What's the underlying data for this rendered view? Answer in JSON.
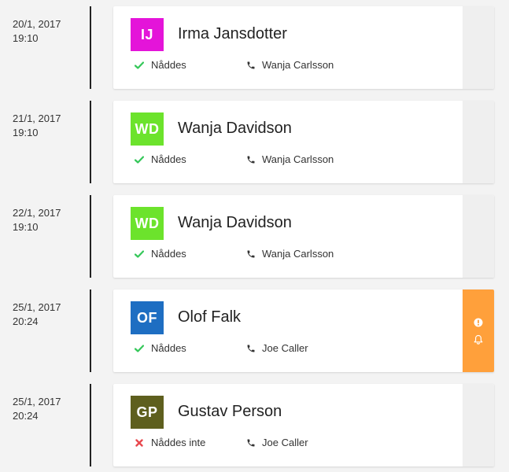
{
  "entries": [
    {
      "date": "20/1, 2017",
      "time": "19:10",
      "initials": "IJ",
      "avatar_color": "#e414d9",
      "name": "Irma Jansdotter",
      "status": "Nåddes",
      "status_icon": "check-icon",
      "status_color": "#34c759",
      "caller": "Wanja Carlsson",
      "side": "plain"
    },
    {
      "date": "21/1, 2017",
      "time": "19:10",
      "initials": "WD",
      "avatar_color": "#6ce32c",
      "name": "Wanja Davidson",
      "status": "Nåddes",
      "status_icon": "check-icon",
      "status_color": "#34c759",
      "caller": "Wanja Carlsson",
      "side": "plain"
    },
    {
      "date": "22/1, 2017",
      "time": "19:10",
      "initials": "WD",
      "avatar_color": "#6ce32c",
      "name": "Wanja Davidson",
      "status": "Nåddes",
      "status_icon": "check-icon",
      "status_color": "#34c759",
      "caller": "Wanja Carlsson",
      "side": "plain"
    },
    {
      "date": "25/1, 2017",
      "time": "20:24",
      "initials": "OF",
      "avatar_color": "#1e6ec2",
      "name": "Olof Falk",
      "status": "Nåddes",
      "status_icon": "check-icon",
      "status_color": "#34c759",
      "caller": "Joe Caller",
      "side": "alert"
    },
    {
      "date": "25/1, 2017",
      "time": "20:24",
      "initials": "GP",
      "avatar_color": "#5e5f1e",
      "name": "Gustav Person",
      "status": "Nåddes inte",
      "status_icon": "cross-icon",
      "status_color": "#e8484e",
      "caller": "Joe Caller",
      "side": "plain"
    }
  ],
  "alert_color": "#ffa03b"
}
